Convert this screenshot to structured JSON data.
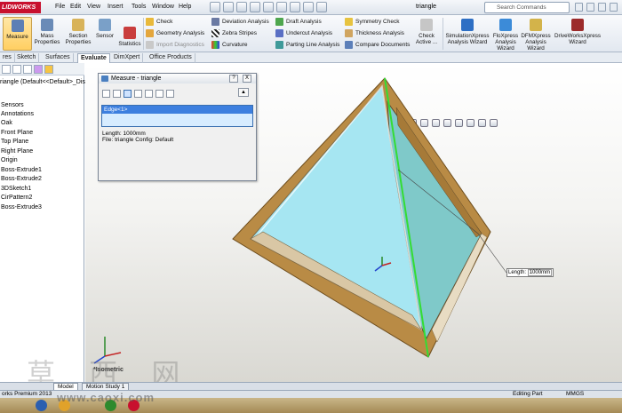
{
  "app": {
    "logo": "LIDWORKS",
    "doc_title": "triangle",
    "search_placeholder": "Search Commands"
  },
  "menus": [
    "File",
    "Edit",
    "View",
    "Insert",
    "Tools",
    "Window",
    "Help"
  ],
  "ribbon": {
    "big": [
      "Measure",
      "Mass Properties",
      "Section Properties",
      "Sensor",
      "Statistics"
    ],
    "col1": [
      "Check",
      "Geometry Analysis",
      "Import Diagnostics"
    ],
    "col2": [
      "Deviation Analysis",
      "Zebra Stripes",
      "Curvature"
    ],
    "col3": [
      "Draft Analysis",
      "Undercut Analysis",
      "Parting Line Analysis"
    ],
    "col4": [
      "Symmetry Check",
      "Thickness Analysis",
      "Compare Documents"
    ],
    "check_active": "Check Active ...",
    "xpress": [
      "SimulationXpress Analysis Wizard",
      "FloXpress Analysis Wizard",
      "DFMXpress Analysis Wizard",
      "DriveWorksXpress Wizard"
    ]
  },
  "tabs": [
    "res",
    "Sketch",
    "Surfaces",
    "Evaluate",
    "DimXpert",
    "Office Products"
  ],
  "active_tab": "Evaluate",
  "tree": {
    "header": "riangle (Default<<Default>_Disp",
    "items": [
      "Sensors",
      "Annotations",
      "Oak",
      "Front Plane",
      "Top Plane",
      "Right Plane",
      "Origin",
      "Boss-Extrude1",
      "Boss-Extrude2",
      "3DSketch1",
      "CirPattern2",
      "Boss-Extrude3"
    ]
  },
  "measure": {
    "title": "Measure - triangle",
    "sys_help": "?",
    "sys_close": "X",
    "selection": "Edge<1>",
    "length": "Length: 1000mm",
    "file": "File: triangle Config: Default"
  },
  "callout": {
    "label": "Length:",
    "value": "1000mm"
  },
  "view_label": "*Isometric",
  "model_tabs": [
    "Model",
    "Motion Study 1"
  ],
  "status": {
    "left": "orks Premium 2013",
    "mode": "Editing Part",
    "units": "MMGS"
  },
  "watermark": {
    "cn": "草 西 网",
    "url": "www.caoxi.com"
  },
  "colors": {
    "accent": "#3d7fdf",
    "wood": "#b98b45",
    "glass": "#9fe0ef",
    "edge": "#33dd33"
  }
}
